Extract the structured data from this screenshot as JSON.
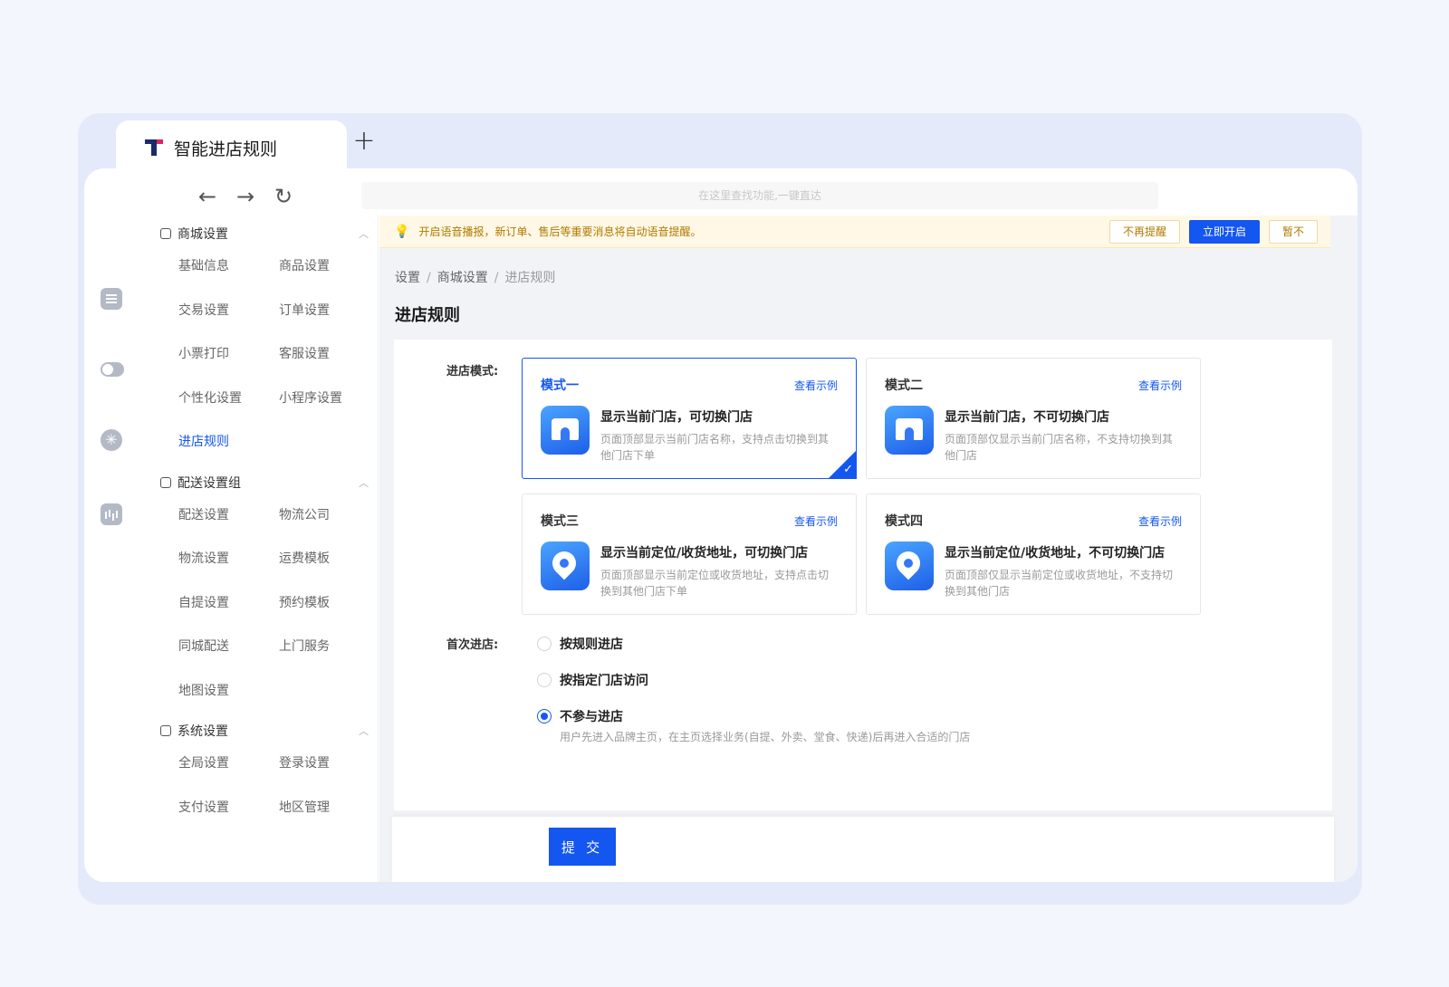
{
  "app": {
    "tab_title": "智能进店规则",
    "new_tab": "+"
  },
  "toolbar": {
    "back": "←",
    "forward": "→",
    "refresh": "↻",
    "search_placeholder": "在这里查找功能,一键直达"
  },
  "sidebar": {
    "groups": [
      {
        "title": "商城设置",
        "items": [
          "基础信息",
          "商品设置",
          "交易设置",
          "订单设置",
          "小票打印",
          "客服设置",
          "个性化设置",
          "小程序设置",
          "进店规则"
        ],
        "active": "进店规则"
      },
      {
        "title": "配送设置组",
        "items": [
          "配送设置",
          "物流公司",
          "物流设置",
          "运费模板",
          "自提设置",
          "预约模板",
          "同城配送",
          "上门服务",
          "地图设置"
        ]
      },
      {
        "title": "系统设置",
        "items": [
          "全局设置",
          "登录设置",
          "支付设置",
          "地区管理"
        ]
      }
    ]
  },
  "notice": {
    "text": "开启语音播报，新订单、售后等重要消息将自动语音提醒。",
    "dismiss": "不再提醒",
    "enable": "立即开启",
    "later": "暂不"
  },
  "breadcrumb": [
    "设置",
    "商城设置",
    "进店规则"
  ],
  "page_title": "进店规则",
  "form": {
    "mode_label": "进店模式:",
    "view_example": "查看示例",
    "modes": [
      {
        "title": "模式一",
        "head": "显示当前门店，可切换门店",
        "desc": "页面顶部显示当前门店名称，支持点击切换到其他门店下单",
        "selected": true
      },
      {
        "title": "模式二",
        "head": "显示当前门店，不可切换门店",
        "desc": "页面顶部仅显示当前门店名称，不支持切换到其他门店",
        "selected": false
      },
      {
        "title": "模式三",
        "head": "显示当前定位/收货地址，可切换门店",
        "desc": "页面顶部显示当前定位或收货地址，支持点击切换到其他门店下单",
        "selected": false
      },
      {
        "title": "模式四",
        "head": "显示当前定位/收货地址，不可切换门店",
        "desc": "页面顶部仅显示当前定位或收货地址，不支持切换到其他门店",
        "selected": false
      }
    ],
    "first_label": "首次进店:",
    "first_options": [
      "按规则进店",
      "按指定门店访问",
      "不参与进店"
    ],
    "first_selected": "不参与进店",
    "first_hint": "用户先进入品牌主页，在主页选择业务(自提、外卖、堂食、快递)后再进入合适的门店",
    "submit": "提 交"
  },
  "colors": {
    "accent": "#1456f0",
    "notice_bg": "#fff8e6"
  }
}
